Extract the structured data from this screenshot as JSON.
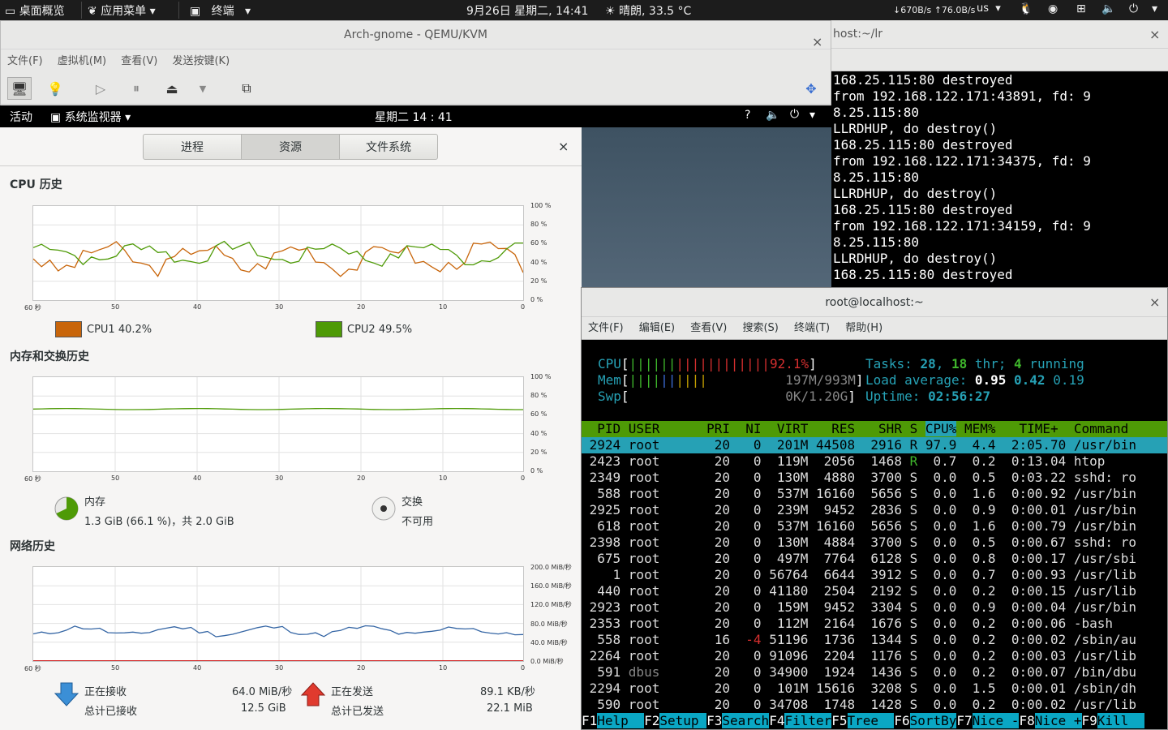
{
  "topbar": {
    "overview": "桌面概览",
    "apps": "应用菜单",
    "terminal": "终端",
    "datetime": "9月26日 星期二, 14:41",
    "weather": "晴朗, 33.5 °C",
    "net": "↓670B/s ↑76.0B/s",
    "kbd": "us"
  },
  "qemu": {
    "title": "Arch-gnome - QEMU/KVM",
    "menu": [
      "文件(F)",
      "虚拟机(M)",
      "查看(V)",
      "发送按键(K)"
    ]
  },
  "guest": {
    "activities": "活动",
    "app": "系统监视器",
    "clock": "星期二 14 : 41"
  },
  "sysmon": {
    "tabs": [
      "进程",
      "资源",
      "文件系统"
    ],
    "cpu_title": "CPU 历史",
    "mem_title": "内存和交换历史",
    "net_title": "网络历史",
    "pct_ticks": [
      "100 %",
      "80 %",
      "60 %",
      "40 %",
      "20 %",
      "0 %"
    ],
    "net_ticks": [
      "200.0 MiB/秒",
      "160.0 MiB/秒",
      "120.0 MiB/秒",
      "80.0 MiB/秒",
      "40.0 MiB/秒",
      "0.0 MiB/秒"
    ],
    "time_ticks": [
      "60 秒",
      "50",
      "40",
      "30",
      "20",
      "10",
      "0"
    ],
    "cpu1": "CPU1 40.2%",
    "cpu2": "CPU2 49.5%",
    "cpu1_color": "#c8650a",
    "cpu2_color": "#4e9a06",
    "mem_label": "内存",
    "mem_value": "1.3 GiB (66.1 %)，共 2.0 GiB",
    "swap_label": "交换",
    "swap_value": "不可用",
    "recv_label": "正在接收",
    "recv_total_label": "总计已接收",
    "recv_rate": "64.0 MiB/秒",
    "recv_total": "12.5 GiB",
    "send_label": "正在发送",
    "send_total_label": "总计已发送",
    "send_rate": "89.1 KB/秒",
    "send_total": "22.1 MiB"
  },
  "term1": {
    "title": "host:~/lr",
    "lines": [
      "168.25.115:80 destroyed",
      "from 192.168.122.171:43891, fd: 9",
      "8.25.115:80",
      "LLRDHUP, do destroy()",
      "168.25.115:80 destroyed",
      "from 192.168.122.171:34375, fd: 9",
      "8.25.115:80",
      "LLRDHUP, do destroy()",
      "168.25.115:80 destroyed",
      "from 192.168.122.171:34159, fd: 9",
      "8.25.115:80",
      "LLRDHUP, do destroy()",
      "168.25.115:80 destroyed"
    ]
  },
  "htopwin": {
    "title": "root@localhost:~",
    "menu": [
      "文件(F)",
      "编辑(E)",
      "查看(V)",
      "搜索(S)",
      "终端(T)",
      "帮助(H)"
    ]
  },
  "htop": {
    "cpu_pct": "92.1%",
    "mem": "197M/993M",
    "swp": "0K/1.20G",
    "tasks": "28",
    "threads": "18",
    "running": "4",
    "load1": "0.95",
    "load5": "0.42",
    "load15": "0.19",
    "uptime": "02:56:27",
    "header": "  PID USER      PRI  NI  VIRT   RES   SHR S CPU% MEM%   TIME+  Command",
    "rows": [
      [
        "2924",
        "root",
        "20",
        "0",
        "201M",
        "44508",
        "2916",
        "R",
        "97.9",
        "4.4",
        "2:05.70",
        "/usr/bin"
      ],
      [
        "2423",
        "root",
        "20",
        "0",
        "119M",
        "2056",
        "1468",
        "R",
        "0.7",
        "0.2",
        "0:13.04",
        "htop"
      ],
      [
        "2349",
        "root",
        "20",
        "0",
        "130M",
        "4880",
        "3700",
        "S",
        "0.0",
        "0.5",
        "0:03.22",
        "sshd: ro"
      ],
      [
        "588",
        "root",
        "20",
        "0",
        "537M",
        "16160",
        "5656",
        "S",
        "0.0",
        "1.6",
        "0:00.92",
        "/usr/bin"
      ],
      [
        "2925",
        "root",
        "20",
        "0",
        "239M",
        "9452",
        "2836",
        "S",
        "0.0",
        "0.9",
        "0:00.01",
        "/usr/bin"
      ],
      [
        "618",
        "root",
        "20",
        "0",
        "537M",
        "16160",
        "5656",
        "S",
        "0.0",
        "1.6",
        "0:00.79",
        "/usr/bin"
      ],
      [
        "2398",
        "root",
        "20",
        "0",
        "130M",
        "4884",
        "3700",
        "S",
        "0.0",
        "0.5",
        "0:00.67",
        "sshd: ro"
      ],
      [
        "675",
        "root",
        "20",
        "0",
        "497M",
        "7764",
        "6128",
        "S",
        "0.0",
        "0.8",
        "0:00.17",
        "/usr/sbi"
      ],
      [
        "1",
        "root",
        "20",
        "0",
        "56764",
        "6644",
        "3912",
        "S",
        "0.0",
        "0.7",
        "0:00.93",
        "/usr/lib"
      ],
      [
        "440",
        "root",
        "20",
        "0",
        "41180",
        "2504",
        "2192",
        "S",
        "0.0",
        "0.2",
        "0:00.15",
        "/usr/lib"
      ],
      [
        "2923",
        "root",
        "20",
        "0",
        "159M",
        "9452",
        "3304",
        "S",
        "0.0",
        "0.9",
        "0:00.04",
        "/usr/bin"
      ],
      [
        "2353",
        "root",
        "20",
        "0",
        "112M",
        "2164",
        "1676",
        "S",
        "0.0",
        "0.2",
        "0:00.06",
        "-bash"
      ],
      [
        "558",
        "root",
        "16",
        "-4",
        "51196",
        "1736",
        "1344",
        "S",
        "0.0",
        "0.2",
        "0:00.02",
        "/sbin/au"
      ],
      [
        "2264",
        "root",
        "20",
        "0",
        "91096",
        "2204",
        "1176",
        "S",
        "0.0",
        "0.2",
        "0:00.03",
        "/usr/lib"
      ],
      [
        "591",
        "dbus",
        "20",
        "0",
        "34900",
        "1924",
        "1436",
        "S",
        "0.0",
        "0.2",
        "0:00.07",
        "/bin/dbu"
      ],
      [
        "2294",
        "root",
        "20",
        "0",
        "101M",
        "15616",
        "3208",
        "S",
        "0.0",
        "1.5",
        "0:00.01",
        "/sbin/dh"
      ],
      [
        "590",
        "root",
        "20",
        "0",
        "34708",
        "1748",
        "1428",
        "S",
        "0.0",
        "0.2",
        "0:00.02",
        "/usr/lib"
      ]
    ],
    "fkeys": [
      [
        "F1",
        "Help  "
      ],
      [
        "F2",
        "Setup "
      ],
      [
        "F3",
        "Search"
      ],
      [
        "F4",
        "Filter"
      ],
      [
        "F5",
        "Tree  "
      ],
      [
        "F6",
        "SortBy"
      ],
      [
        "F7",
        "Nice -"
      ],
      [
        "F8",
        "Nice +"
      ],
      [
        "F9",
        "Kill  "
      ]
    ]
  }
}
